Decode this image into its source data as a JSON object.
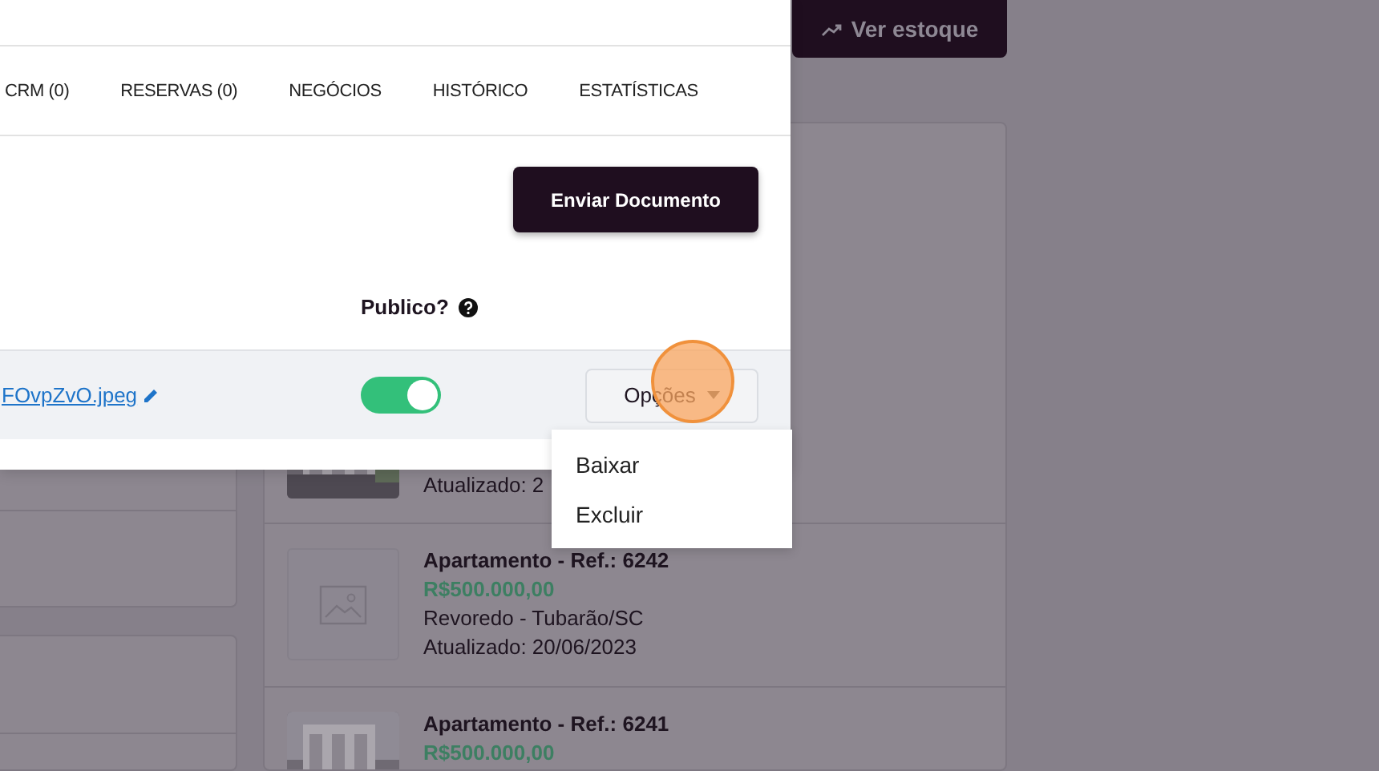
{
  "background": {
    "stock_button": "Ver estoque",
    "listings": [
      {
        "kind": "picture",
        "date": "Atualizado: 2"
      },
      {
        "kind": "placeholder",
        "title": "Apartamento - Ref.: 6242",
        "price": "R$500.000,00",
        "address": "Revoredo - Tubarão/SC",
        "date": "Atualizado: 20/06/2023"
      },
      {
        "kind": "picture",
        "title": "Apartamento - Ref.: 6241",
        "price": "R$500.000,00"
      }
    ]
  },
  "modal": {
    "tabs": [
      {
        "label": "CRM (0)",
        "selected": false
      },
      {
        "label": "RESERVAS (0)",
        "selected": false
      },
      {
        "label": "NEGÓCIOS",
        "selected": false
      },
      {
        "label": "HISTÓRICO",
        "selected": false
      },
      {
        "label": "ESTATÍSTICAS",
        "selected": false
      }
    ],
    "send_button": "Enviar Documento",
    "public_header": "Publico?",
    "document": {
      "filename": "FOvpZvO.jpeg",
      "public": true,
      "options_button": "Opções"
    },
    "menu": [
      "Baixar",
      "Excluir"
    ]
  }
}
